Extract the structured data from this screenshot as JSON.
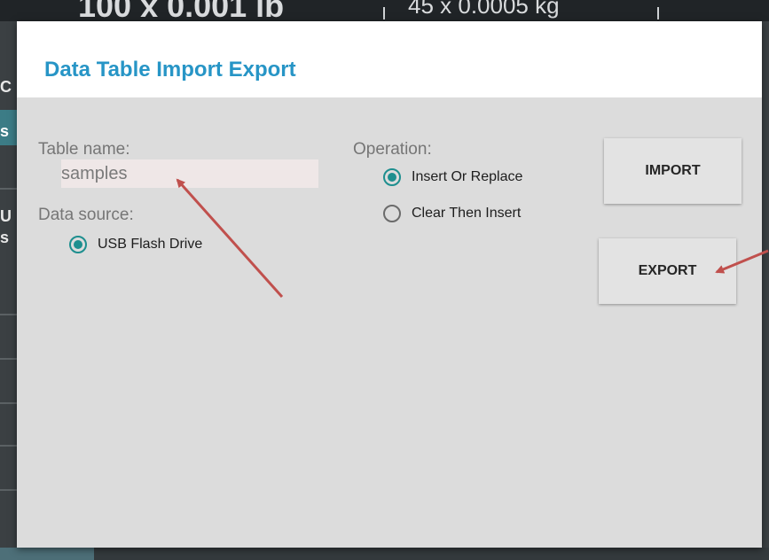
{
  "background": {
    "top_left_text": "100 x 0.001 lb",
    "top_right_text": "45 x 0.0005 kg",
    "left_fragments": [
      "C",
      "s",
      "U",
      "s"
    ]
  },
  "dialog": {
    "title": "Data Table Import Export",
    "table_name_label": "Table name:",
    "table_name_value": "samples",
    "data_source_label": "Data source:",
    "data_source_options": [
      {
        "label": "USB Flash Drive",
        "checked": true
      }
    ],
    "operation_label": "Operation:",
    "operation_options": [
      {
        "label": "Insert Or Replace",
        "checked": true
      },
      {
        "label": "Clear Then Insert",
        "checked": false
      }
    ],
    "import_label": "IMPORT",
    "export_label": "EXPORT"
  },
  "colors": {
    "title": "#2795c6",
    "radio_checked": "#1e8f8f",
    "annotation_arrow": "#c0504d"
  }
}
